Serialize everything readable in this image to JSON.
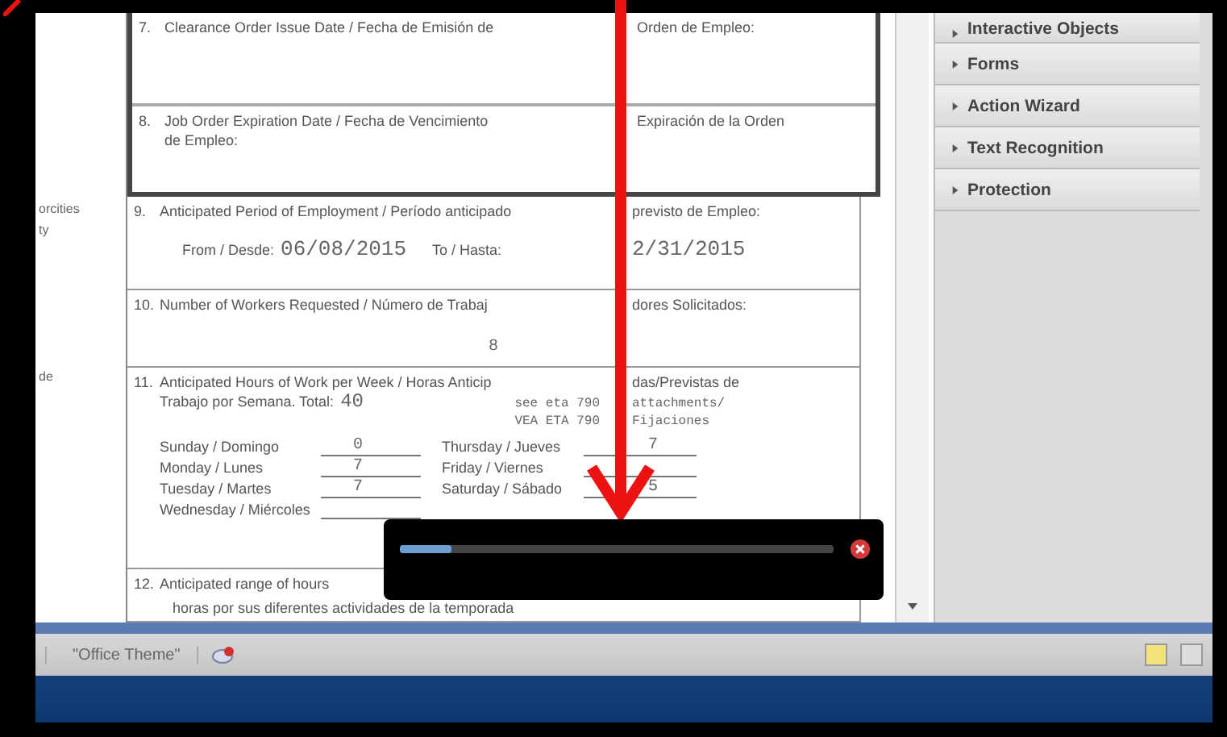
{
  "document": {
    "margin_notes": [
      "orcities",
      "ty",
      "de"
    ],
    "items": [
      {
        "kind": "blank",
        "number": "7.",
        "label": [
          "Clearance Order Issue Date / Fecha de Emisión de",
          "Orden de Empleo:"
        ]
      },
      {
        "kind": "blank",
        "number": "8.",
        "label": [
          "Job Order Expiration Date / Fecha de Vencimiento",
          "Expiración de la Orden"
        ],
        "line2": "de Empleo:"
      },
      {
        "kind": "period",
        "number": "9.",
        "label": [
          "Anticipated Period of Employment / Período anticipado",
          "previsto de Empleo:"
        ],
        "from_label": "From / Desde:",
        "from": "06/08/2015",
        "to_label": "To / Hasta:",
        "to": "2/31/2015"
      },
      {
        "kind": "value",
        "number": "10.",
        "label": [
          "Number of Workers Requested / Número de Trabaj",
          "dores Solicitados:"
        ],
        "value": "8"
      },
      {
        "kind": "hours",
        "number": "11.",
        "label": [
          "Anticipated Hours of Work per Week / Horas Anticip",
          "das/Previstas de"
        ],
        "line2": "Trabajo por Semana. Total:",
        "total": "40",
        "note": [
          [
            "see eta 790",
            "attachments/"
          ],
          [
            "VEA ETA 790",
            "Fijaciones"
          ]
        ],
        "days": [
          {
            "label": "Sunday / Domingo",
            "value": "0"
          },
          {
            "label": "Thursday / Jueves",
            "value": "7"
          },
          {
            "label": "Monday / Lunes",
            "value": "7"
          },
          {
            "label": "Friday / Viernes"
          },
          {
            "label": "Tuesday / Martes",
            "value": "7"
          },
          {
            "label": "Saturday / Sábado",
            "value": "5"
          },
          {
            "label": "Wednesday / Miércoles"
          }
        ]
      },
      {
        "kind": "blank",
        "number": "12.",
        "label": [
          "Anticipated range of hours"
        ],
        "line2": "horas por sus diferentes actividades de la temporada"
      }
    ]
  },
  "tools_panel": {
    "panels": [
      {
        "label": "Interactive Objects",
        "expanded": false
      },
      {
        "label": "Forms",
        "expanded": false
      },
      {
        "label": "Action Wizard",
        "expanded": false
      },
      {
        "label": "Text Recognition",
        "expanded": false
      },
      {
        "label": "Protection",
        "expanded": false
      }
    ]
  },
  "progress": {
    "level": 0.12
  },
  "status_bar": {
    "theme": "\"Office Theme\""
  }
}
